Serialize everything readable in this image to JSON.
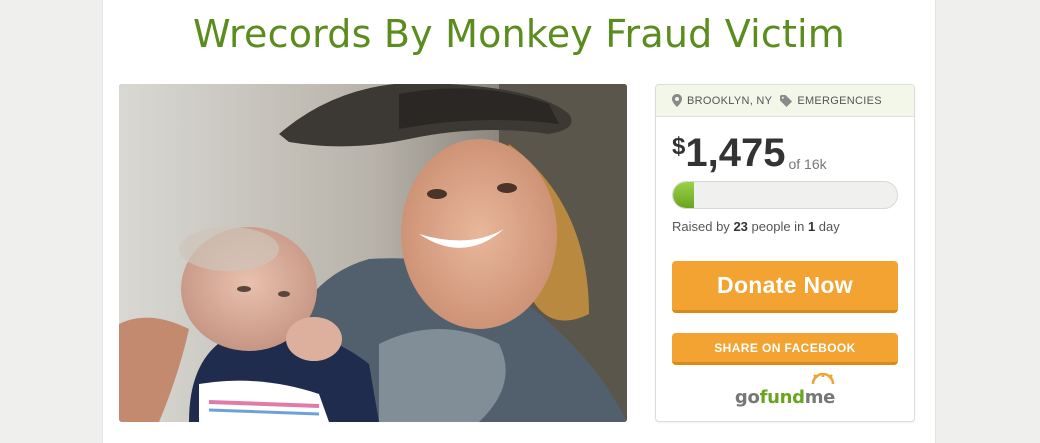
{
  "campaign": {
    "title": "Wrecords By Monkey Fraud Victim"
  },
  "meta": {
    "location": "BROOKLYN, NY",
    "category": "EMERGENCIES",
    "location_icon": "map-pin-icon",
    "category_icon": "tag-icon"
  },
  "funding": {
    "currency": "$",
    "amount": "1,475",
    "of_label": "of 16k",
    "progress_fraction": 0.092,
    "raised_prefix": "Raised by",
    "people_count": "23",
    "people_mid": "people in",
    "days_count": "1",
    "days_suffix": "day"
  },
  "actions": {
    "donate_label": "Donate Now",
    "share_label": "SHARE ON FACEBOOK"
  },
  "brand": {
    "logo_go": "go",
    "logo_fund": "fund",
    "logo_me": "me"
  },
  "colors": {
    "title_green": "#5a8c1e",
    "button_orange": "#f2a331",
    "progress_green": "#6aa51f"
  }
}
